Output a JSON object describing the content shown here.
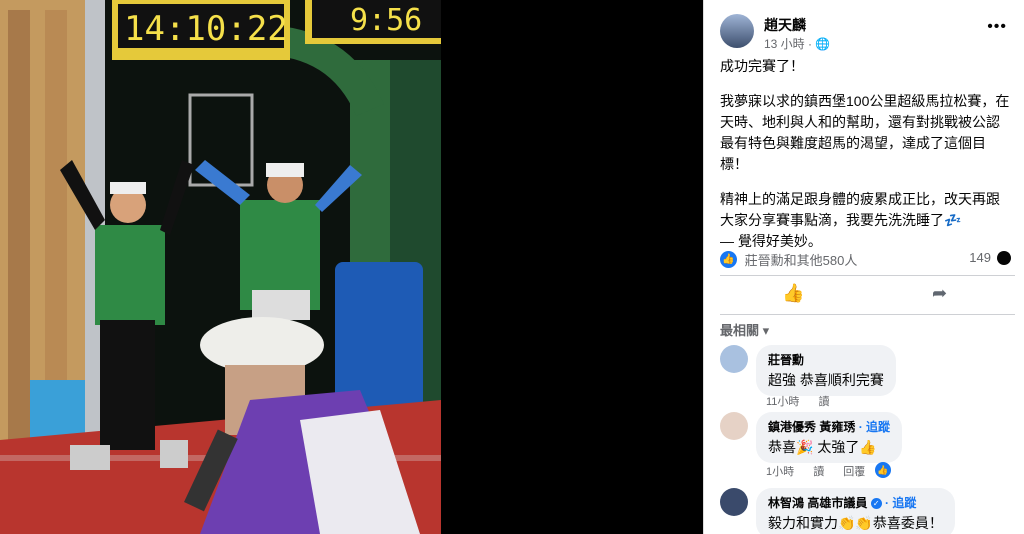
{
  "photo": {
    "clock_left": "14:10:22",
    "clock_right": "9:56"
  },
  "post": {
    "author": "趙天麟",
    "time": "13 小時 · ",
    "more_icon": "•••",
    "para1": "成功完賽了！",
    "para2": "我夢寐以求的鎮西堡100公里超級馬拉松賽，在天時、地利與人和的幫助，還有對挑戰被公認最有特色與難度超馬的渴望，達成了這個目標！",
    "para3": "精神上的滿足跟身體的疲累成正比，改天再跟大家分享賽事點滴，我要先洗洗睡了💤",
    "feeling": "— 覺得好美妙。"
  },
  "reactions": {
    "names": "莊晉勳和其他580人",
    "comment_count": "149"
  },
  "sort_label": "最相關 ▾",
  "comments": [
    {
      "name": "莊晉勳",
      "text": "超強 恭喜順利完賽",
      "time": "11小時",
      "reply": "讀"
    },
    {
      "name": "鎮港優秀 黃雍琇",
      "follow": "· 追蹤",
      "text": "恭喜🎉 太強了👍",
      "time": "1小時",
      "reply": "讀",
      "hide": "回覆"
    },
    {
      "name": "林智鴻 高雄市議員",
      "follow": "· 追蹤",
      "text": "毅力和實力👏👏恭喜委員！"
    }
  ]
}
